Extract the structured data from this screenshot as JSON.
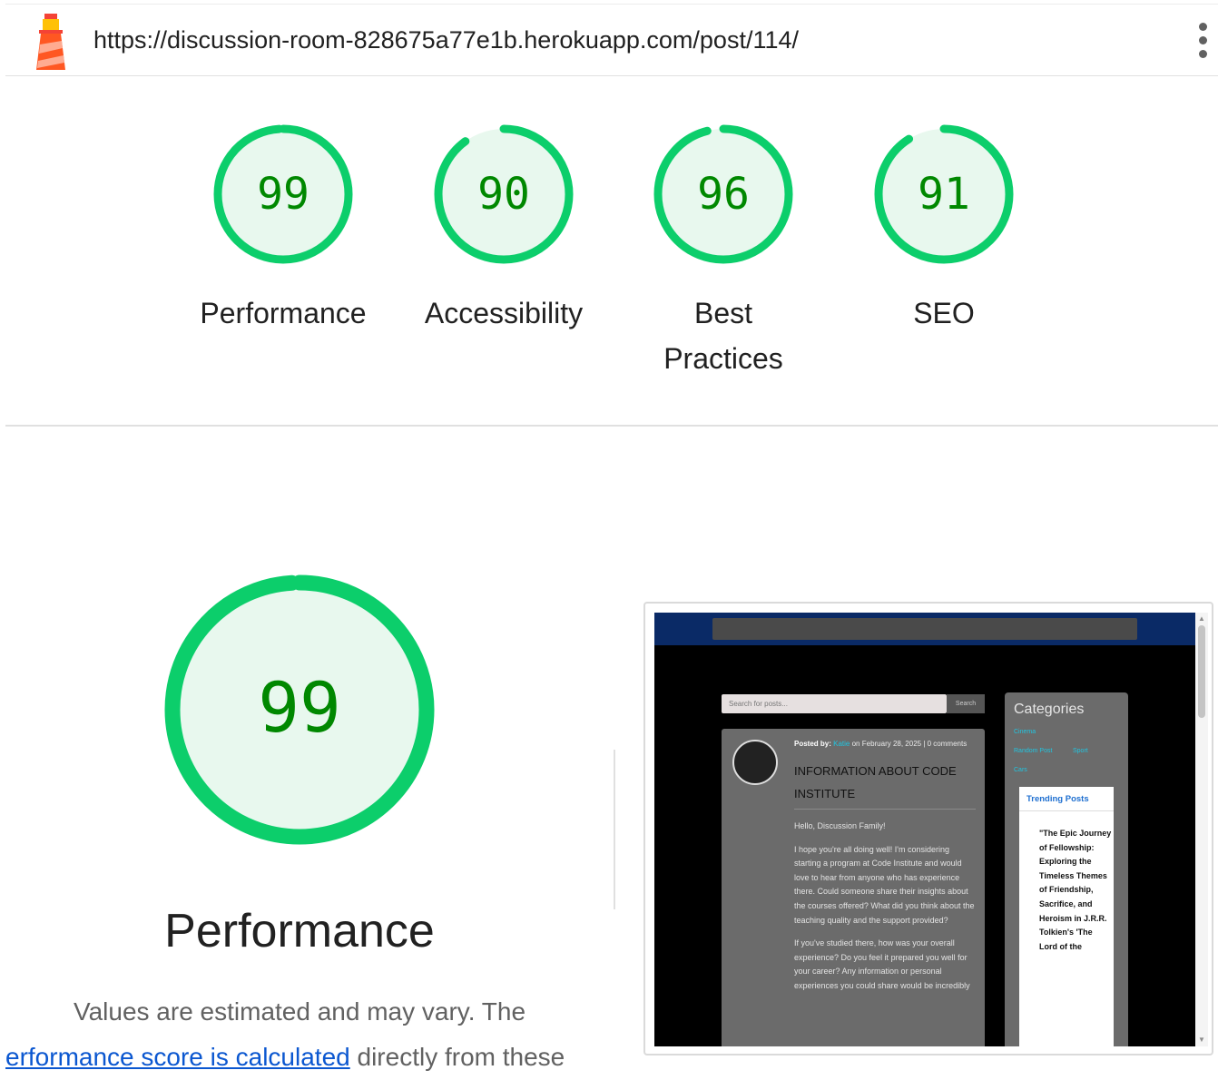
{
  "header": {
    "url": "https://discussion-room-828675a77e1b.herokuapp.com/post/114/"
  },
  "colors": {
    "pass": "#0cce6b",
    "pass_text": "#008800",
    "pass_fill": "#e8f8ee",
    "link": "#0b57d0"
  },
  "scores": [
    {
      "label": "Performance",
      "value": "99"
    },
    {
      "label": "Accessibility",
      "value": "90"
    },
    {
      "label": "Best Practices",
      "value": "96",
      "label_line1": "Best",
      "label_line2": "Practices"
    },
    {
      "label": "SEO",
      "value": "91"
    }
  ],
  "detail": {
    "score": "99",
    "title": "Performance",
    "desc_line1": "Values are estimated and may vary. The",
    "desc_link": "erformance score is calculated",
    "desc_rest": " directly from these"
  },
  "screenshot": {
    "search_placeholder": "Search for posts...",
    "search_button": "Search",
    "posted_by": "Posted by:",
    "author": "Katie",
    "posted_meta": "on February 28, 2025 | 0 comments",
    "post_title": "INFORMATION ABOUT CODE INSTITUTE",
    "greeting": "Hello, Discussion Family!",
    "para1": "I hope you're all doing well! I'm considering starting a program at Code Institute and would love to hear from anyone who has experience there. Could someone share their insights about the courses offered? What did you think about the teaching quality and the support provided?",
    "para2": "If you've studied there, how was your overall experience? Do you feel it prepared you well for your career? Any information or personal experiences you could share would be incredibly",
    "categories_title": "Categories",
    "categories": [
      "Cinema",
      "Random Post",
      "Sport",
      "Cars"
    ],
    "trending_title": "Trending Posts",
    "trending_item": "\"The Epic Journey of Fellowship: Exploring the Timeless Themes of Friendship, Sacrifice, and Heroism in J.R.R. Tolkien's 'The Lord of the"
  }
}
